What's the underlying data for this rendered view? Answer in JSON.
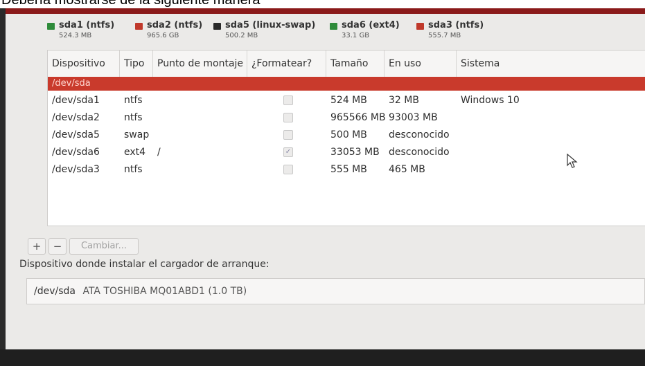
{
  "caption": "Debería mostrarse de la siguiente manera",
  "colors": {
    "ntfs": "#2e8b3a",
    "ntfs_sda2": "#c0392b",
    "swap": "#2a2a2a",
    "ext4": "#2e8b3a",
    "ntfs_sda3": "#c0392b",
    "selected_row": "#c93a2c"
  },
  "legend": [
    {
      "name": "sda1 (ntfs)",
      "size": "524.3 MB",
      "color_key": "ntfs"
    },
    {
      "name": "sda2 (ntfs)",
      "size": "965.6 GB",
      "color_key": "ntfs_sda2"
    },
    {
      "name": "sda5 (linux-swap)",
      "size": "500.2 MB",
      "color_key": "swap"
    },
    {
      "name": "sda6 (ext4)",
      "size": "33.1 GB",
      "color_key": "ext4"
    },
    {
      "name": "sda3 (ntfs)",
      "size": "555.7 MB",
      "color_key": "ntfs_sda3"
    }
  ],
  "table": {
    "columns": [
      "Dispositivo",
      "Tipo",
      "Punto de montaje",
      "¿Formatear?",
      "Tamaño",
      "En uso",
      "Sistema"
    ],
    "device_group": "/dev/sda",
    "rows": [
      {
        "device": "/dev/sda1",
        "type": "ntfs",
        "mount": "",
        "format": false,
        "size": "524 MB",
        "used": "32 MB",
        "system": "Windows 10"
      },
      {
        "device": "/dev/sda2",
        "type": "ntfs",
        "mount": "",
        "format": false,
        "size": "965566 MB",
        "used": "93003 MB",
        "system": ""
      },
      {
        "device": "/dev/sda5",
        "type": "swap",
        "mount": "",
        "format": false,
        "size": "500 MB",
        "used": "desconocido",
        "system": ""
      },
      {
        "device": "/dev/sda6",
        "type": "ext4",
        "mount": "/",
        "format": true,
        "size": "33053 MB",
        "used": "desconocido",
        "system": ""
      },
      {
        "device": "/dev/sda3",
        "type": "ntfs",
        "mount": "",
        "format": false,
        "size": "555 MB",
        "used": "465 MB",
        "system": ""
      }
    ]
  },
  "toolbar": {
    "add_label": "+",
    "remove_label": "−",
    "change_label": "Cambiar..."
  },
  "bootloader": {
    "label": "Dispositivo donde instalar el cargador de arranque:",
    "device": "/dev/sda",
    "model": "ATA TOSHIBA MQ01ABD1 (1.0 TB)"
  },
  "icons": {
    "cursor": "mouse-pointer-icon",
    "checkbox_checked": "✓"
  }
}
